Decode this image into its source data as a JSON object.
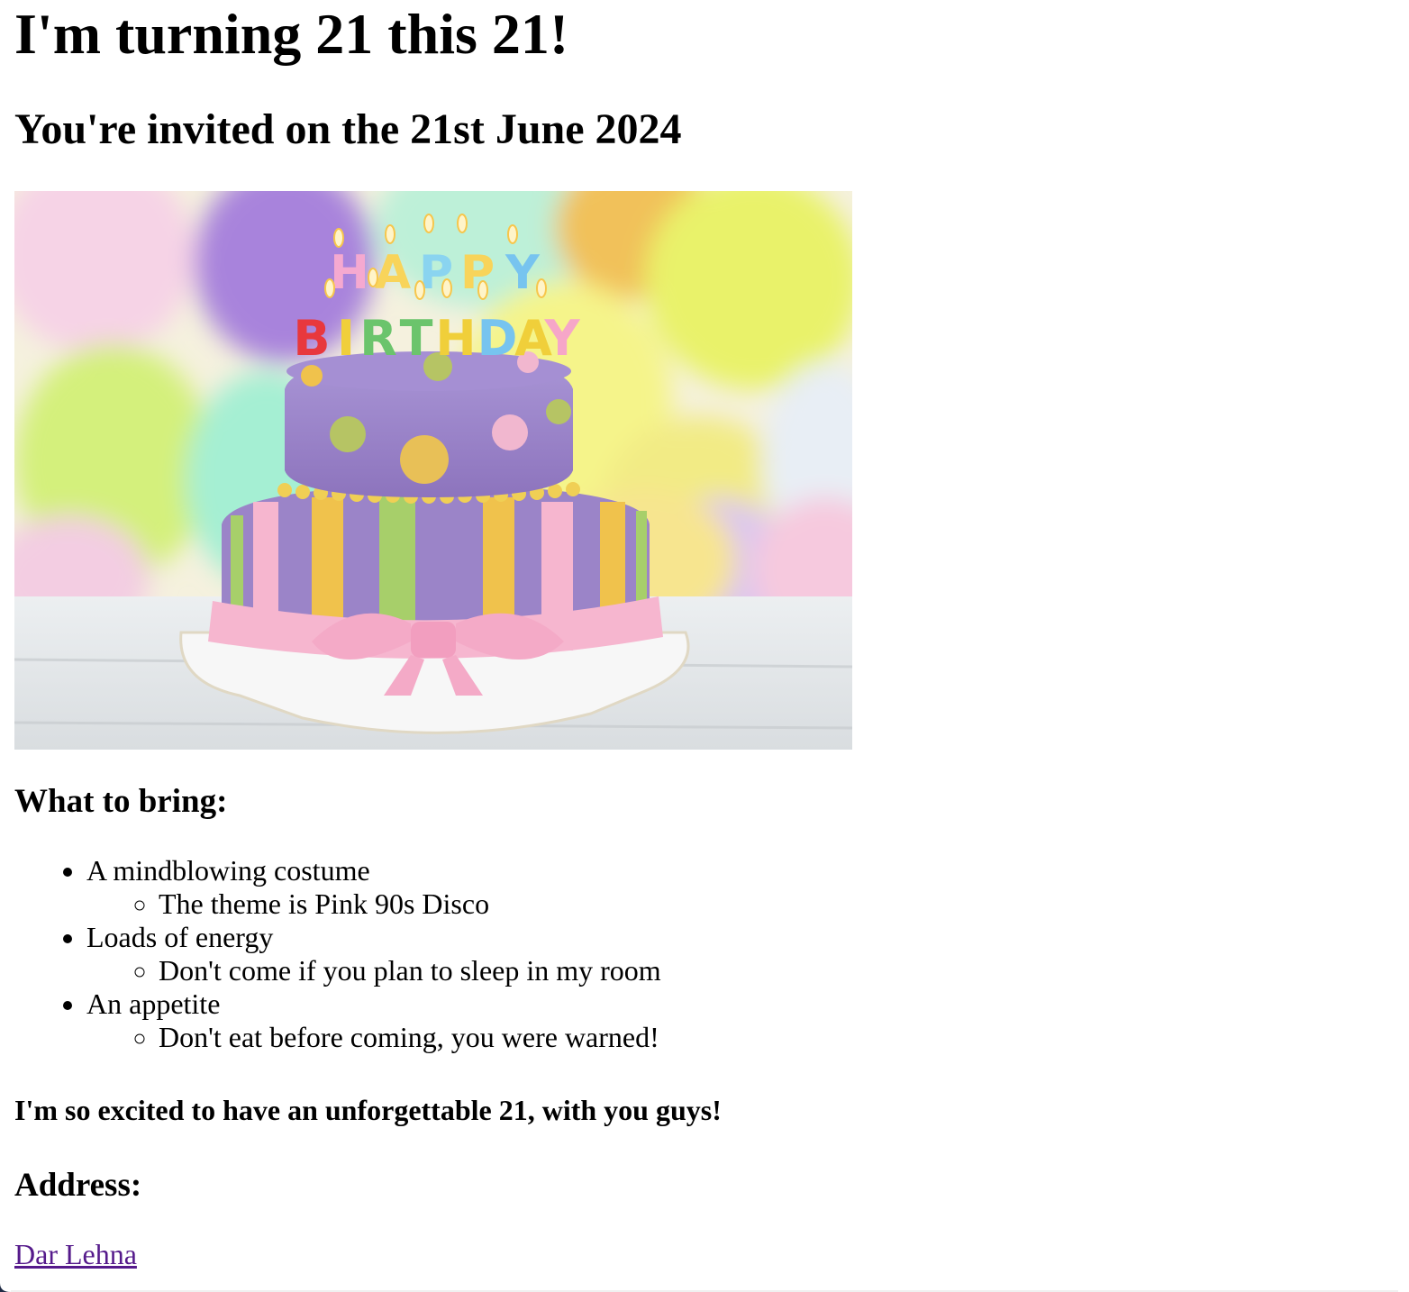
{
  "page": {
    "heading": "I'm turning 21 this 21!",
    "subheading": "You're invited on the 21st June 2024",
    "image": {
      "candle_letters_top": "HAPPY",
      "candle_letters_bottom": "BIRTHDAY",
      "colors": {
        "cake_purple": "#9b84c8",
        "stripe_yellow": "#f0c24c",
        "stripe_green": "#a7cf6a",
        "stripe_pink": "#f6b6cf",
        "board_white": "#f4f4f4"
      }
    },
    "bring_heading": "What to bring:",
    "bring_items": [
      {
        "label": "A mindblowing costume",
        "note": "The theme is Pink 90s Disco"
      },
      {
        "label": "Loads of energy",
        "note": "Don't come if you plan to sleep in my room"
      },
      {
        "label": "An appetite",
        "note": "Don't eat before coming, you were warned!"
      }
    ],
    "excited_text": "I'm so excited to have an unforgettable 21, with you guys!",
    "address_heading": "Address:",
    "address_link": "Dar Lehna"
  }
}
